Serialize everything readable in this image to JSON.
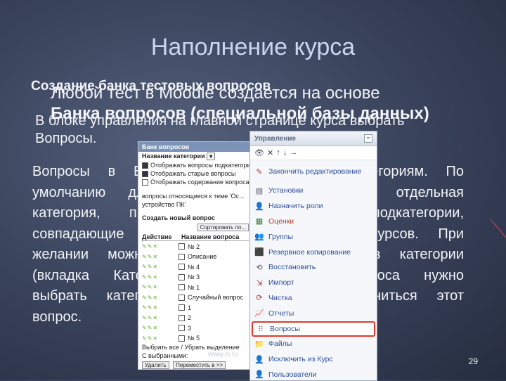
{
  "slide": {
    "title": "Наполнение курса",
    "heading_line1": "Создание банка тестовых вопросов",
    "overlay_line1": "Любой тест в Moodle создается на основе",
    "overlay_line2": "Банка вопросов (специальной базы данных)",
    "overlay_line3": "В блоке управления на главной странице курса выбрать",
    "line_questions": "Вопросы.",
    "body_lines": [
      "Вопросы в Банке распределяются по категориям. По",
      "умолчанию для каждого курса создается отдельная",
      "категория, причем можно создавать подкатегории,",
      "совпадающие с темами или разделами курсов. При",
      "желании можно создать новые вопросы в категории",
      "(вкладка Категории). При создании вопроса нужно",
      "выбрать категорию, в которой будет храниться этот",
      "вопрос."
    ],
    "slide_number": "29",
    "footer_text": "www.ci.ru"
  },
  "bank": {
    "header": "Банк вопросов",
    "category_label": "Название категории",
    "options": [
      {
        "label": "Отображать вопросы подкатегорий",
        "checked": true
      },
      {
        "label": "Отображать старые вопросы",
        "checked": true
      },
      {
        "label": "Отображать содержание вопроса",
        "checked": false
      }
    ],
    "desc": "вопросы относящиеся к теме 'Ос...",
    "desc2": "устройство ПК'",
    "create_label": "Создать новый вопрос",
    "sort_label": "Сортировать по...",
    "col_action": "Действие",
    "col_name": "Название вопроса",
    "questions": [
      "№ 2",
      "Описание",
      "№ 4",
      "№ 3",
      "№ 1",
      "Случайный вопрос",
      "1",
      "2",
      "3",
      "№ 5"
    ],
    "footer_select": "Выбрать все / Убрать выделение",
    "with_selected": "С выбранными:",
    "btn_delete": "Удалить",
    "btn_move": "Переместить в >>"
  },
  "admin": {
    "header": "Управление",
    "items": [
      {
        "label": "Закончить редактирование",
        "icon": "pencil-icon",
        "color": "#c0392b"
      },
      {
        "label": "Установки",
        "icon": "settings-doc-icon",
        "color": "#556"
      },
      {
        "label": "Назначить роли",
        "icon": "roles-icon",
        "color": "#8a6d3b"
      },
      {
        "label": "Оценки",
        "icon": "grades-icon",
        "color": "#2e7d32"
      },
      {
        "label": "Группы",
        "icon": "groups-icon",
        "color": "#6d4c41"
      },
      {
        "label": "Резервное копирование",
        "icon": "backup-icon",
        "color": "#444"
      },
      {
        "label": "Восстановить",
        "icon": "restore-icon",
        "color": "#555"
      },
      {
        "label": "Импорт",
        "icon": "import-icon",
        "color": "#b03a2e"
      },
      {
        "label": "Чистка",
        "icon": "clean-icon",
        "color": "#b03a2e"
      },
      {
        "label": "Отчеты",
        "icon": "reports-icon",
        "color": "#3b5998"
      },
      {
        "label": "Вопросы",
        "icon": "questions-icon",
        "color": "#333"
      },
      {
        "label": "Файлы",
        "icon": "files-icon",
        "color": "#d4a017"
      },
      {
        "label": "Исключить из Курс",
        "icon": "unenrol-icon",
        "color": "#3b5998"
      },
      {
        "label": "Пользователи",
        "icon": "users-icon",
        "color": "#3b5998"
      }
    ],
    "highlight_color": "#e23a2a"
  }
}
